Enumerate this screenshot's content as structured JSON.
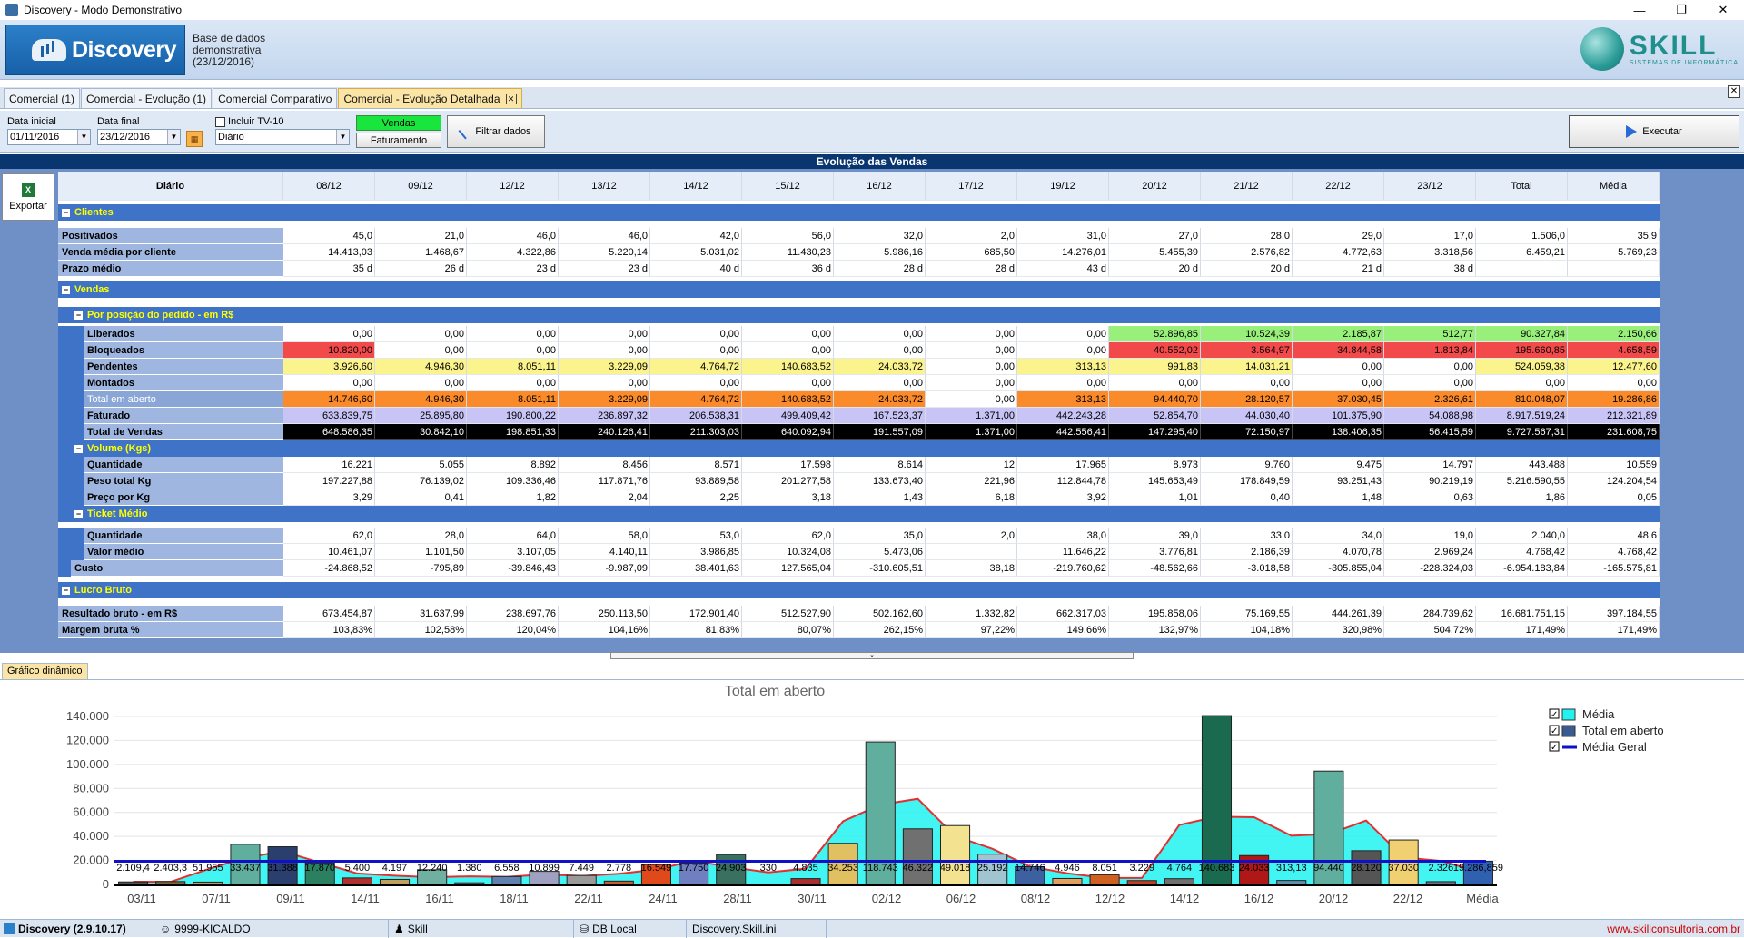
{
  "window": {
    "title": "Discovery - Modo Demonstrativo",
    "minimize": "—",
    "restore": "❐",
    "close": "✕"
  },
  "banner": {
    "app_name": "Discovery",
    "db_info": [
      "Base de dados",
      "demonstrativa",
      "(23/12/2016)"
    ],
    "brand": "SKILL",
    "brand_sub": "SISTEMAS DE INFORMÁTICA"
  },
  "tabs": [
    {
      "label": "Comercial (1)"
    },
    {
      "label": "Comercial - Evolução (1)"
    },
    {
      "label": "Comercial Comparativo"
    },
    {
      "label": "Comercial - Evolução Detalhada",
      "active": true
    }
  ],
  "toolbar": {
    "data_inicial_label": "Data inicial",
    "data_inicial": "01/11/2016",
    "data_final_label": "Data final",
    "data_final": "23/12/2016",
    "incluir_label": "Incluir TV-10",
    "periodo": "Diário",
    "vendas_label": "Vendas",
    "faturamento_label": "Faturamento",
    "filtrar_label": "Filtrar dados",
    "executar_label": "Executar",
    "export_label": "Exportar"
  },
  "section_title": "Evolução das Vendas",
  "grid": {
    "corner": "Diário",
    "columns": [
      "08/12",
      "09/12",
      "12/12",
      "13/12",
      "14/12",
      "15/12",
      "16/12",
      "17/12",
      "19/12",
      "20/12",
      "21/12",
      "22/12",
      "23/12",
      "Total",
      "Média"
    ],
    "groups": {
      "clientes": "Clientes",
      "vendas": "Vendas",
      "posicao": "Por posição do pedido - em R$",
      "volume": "Volume (Kgs)",
      "ticket": "Ticket Médio",
      "lucro": "Lucro Bruto"
    },
    "rows": {
      "positivados": {
        "label": "Positivados",
        "values": [
          "45,0",
          "21,0",
          "46,0",
          "46,0",
          "42,0",
          "56,0",
          "32,0",
          "2,0",
          "31,0",
          "27,0",
          "28,0",
          "29,0",
          "17,0",
          "1.506,0",
          "35,9"
        ]
      },
      "venda_media": {
        "label": "Venda média por cliente",
        "values": [
          "14.413,03",
          "1.468,67",
          "4.322,86",
          "5.220,14",
          "5.031,02",
          "11.430,23",
          "5.986,16",
          "685,50",
          "14.276,01",
          "5.455,39",
          "2.576,82",
          "4.772,63",
          "3.318,56",
          "6.459,21",
          "5.769,23"
        ]
      },
      "prazo": {
        "label": "Prazo médio",
        "values": [
          "35 d",
          "26 d",
          "23 d",
          "23 d",
          "40 d",
          "36 d",
          "28 d",
          "28 d",
          "43 d",
          "20 d",
          "20 d",
          "21 d",
          "38 d",
          "",
          ""
        ]
      },
      "liberados": {
        "label": "Liberados",
        "values": [
          "0,00",
          "0,00",
          "0,00",
          "0,00",
          "0,00",
          "0,00",
          "0,00",
          "0,00",
          "0,00",
          "52.896,85",
          "10.524,39",
          "2.185,87",
          "512,77",
          "90.327,84",
          "2.150,66"
        ]
      },
      "bloqueados": {
        "label": "Bloqueados",
        "values": [
          "10.820,00",
          "0,00",
          "0,00",
          "0,00",
          "0,00",
          "0,00",
          "0,00",
          "0,00",
          "0,00",
          "40.552,02",
          "3.564,97",
          "34.844,58",
          "1.813,84",
          "195.660,85",
          "4.658,59"
        ]
      },
      "pendentes": {
        "label": "Pendentes",
        "values": [
          "3.926,60",
          "4.946,30",
          "8.051,11",
          "3.229,09",
          "4.764,72",
          "140.683,52",
          "24.033,72",
          "0,00",
          "313,13",
          "991,83",
          "14.031,21",
          "0,00",
          "0,00",
          "524.059,38",
          "12.477,60"
        ]
      },
      "montados": {
        "label": "Montados",
        "values": [
          "0,00",
          "0,00",
          "0,00",
          "0,00",
          "0,00",
          "0,00",
          "0,00",
          "0,00",
          "0,00",
          "0,00",
          "0,00",
          "0,00",
          "0,00",
          "0,00",
          "0,00"
        ]
      },
      "total_aberto": {
        "label": "Total em aberto",
        "values": [
          "14.746,60",
          "4.946,30",
          "8.051,11",
          "3.229,09",
          "4.764,72",
          "140.683,52",
          "24.033,72",
          "0,00",
          "313,13",
          "94.440,70",
          "28.120,57",
          "37.030,45",
          "2.326,61",
          "810.048,07",
          "19.286,86"
        ]
      },
      "faturado": {
        "label": "Faturado",
        "values": [
          "633.839,75",
          "25.895,80",
          "190.800,22",
          "236.897,32",
          "206.538,31",
          "499.409,42",
          "167.523,37",
          "1.371,00",
          "442.243,28",
          "52.854,70",
          "44.030,40",
          "101.375,90",
          "54.088,98",
          "8.917.519,24",
          "212.321,89"
        ]
      },
      "total_vendas": {
        "label": "Total de Vendas",
        "values": [
          "648.586,35",
          "30.842,10",
          "198.851,33",
          "240.126,41",
          "211.303,03",
          "640.092,94",
          "191.557,09",
          "1.371,00",
          "442.556,41",
          "147.295,40",
          "72.150,97",
          "138.406,35",
          "56.415,59",
          "9.727.567,31",
          "231.608,75"
        ]
      },
      "quantidade_vol": {
        "label": "Quantidade",
        "values": [
          "16.221",
          "5.055",
          "8.892",
          "8.456",
          "8.571",
          "17.598",
          "8.614",
          "12",
          "17.965",
          "8.973",
          "9.760",
          "9.475",
          "14.797",
          "443.488",
          "10.559"
        ]
      },
      "peso_total": {
        "label": "Peso total Kg",
        "values": [
          "197.227,88",
          "76.139,02",
          "109.336,46",
          "117.871,76",
          "93.889,58",
          "201.277,58",
          "133.673,40",
          "221,96",
          "112.844,78",
          "145.653,49",
          "178.849,59",
          "93.251,43",
          "90.219,19",
          "5.216.590,55",
          "124.204,54"
        ]
      },
      "preco_kg": {
        "label": "Preço por Kg",
        "values": [
          "3,29",
          "0,41",
          "1,82",
          "2,04",
          "2,25",
          "3,18",
          "1,43",
          "6,18",
          "3,92",
          "1,01",
          "0,40",
          "1,48",
          "0,63",
          "1,86",
          "0,05"
        ]
      },
      "quantidade_tm": {
        "label": "Quantidade",
        "values": [
          "62,0",
          "28,0",
          "64,0",
          "58,0",
          "53,0",
          "62,0",
          "35,0",
          "2,0",
          "38,0",
          "39,0",
          "33,0",
          "34,0",
          "19,0",
          "2.040,0",
          "48,6"
        ]
      },
      "valor_medio": {
        "label": "Valor médio",
        "values": [
          "10.461,07",
          "1.101,50",
          "3.107,05",
          "4.140,11",
          "3.986,85",
          "10.324,08",
          "5.473,06",
          "",
          "11.646,22",
          "3.776,81",
          "2.186,39",
          "4.070,78",
          "2.969,24",
          "4.768,42",
          "4.768,42"
        ]
      },
      "custo": {
        "label": "Custo",
        "values": [
          "-24.868,52",
          "-795,89",
          "-39.846,43",
          "-9.987,09",
          "38.401,63",
          "127.565,04",
          "-310.605,51",
          "38,18",
          "-219.760,62",
          "-48.562,66",
          "-3.018,58",
          "-305.855,04",
          "-228.324,03",
          "-6.954.183,84",
          "-165.575,81"
        ]
      },
      "resultado": {
        "label": "Resultado bruto - em R$",
        "values": [
          "673.454,87",
          "31.637,99",
          "238.697,76",
          "250.113,50",
          "172.901,40",
          "512.527,90",
          "502.162,60",
          "1.332,82",
          "662.317,03",
          "195.858,06",
          "75.169,55",
          "444.261,39",
          "284.739,62",
          "16.681.751,15",
          "397.184,55"
        ]
      },
      "margem": {
        "label": "Margem bruta %",
        "values": [
          "103,83%",
          "102,58%",
          "120,04%",
          "104,16%",
          "81,83%",
          "80,07%",
          "262,15%",
          "97,22%",
          "149,66%",
          "132,97%",
          "104,18%",
          "320,98%",
          "504,72%",
          "171,49%",
          "171,49%"
        ]
      }
    }
  },
  "chart_tab": "Gráfico dinâmico",
  "chart_data": {
    "type": "bar",
    "title": "Total em aberto",
    "ylim": [
      0,
      140000
    ],
    "y_ticks": [
      "0",
      "20.000",
      "40.000",
      "60.000",
      "80.000",
      "100.000",
      "120.000",
      "140.000"
    ],
    "x_tick_labels": [
      "03/11",
      "07/11",
      "09/11",
      "14/11",
      "16/11",
      "18/11",
      "22/11",
      "24/11",
      "28/11",
      "30/11",
      "02/12",
      "06/12",
      "08/12",
      "12/12",
      "14/12",
      "16/12",
      "20/12",
      "22/12",
      "Média"
    ],
    "bars": [
      2109,
      2403,
      1955,
      33437,
      31388,
      17870,
      5400,
      4197,
      12240,
      1380,
      6558,
      10899,
      7449,
      2778,
      16549,
      17750,
      24903,
      330,
      4835,
      34253,
      118743,
      46322,
      49018,
      25192,
      14746,
      4946,
      8051,
      3229,
      4764,
      140683,
      24033,
      3313,
      94440,
      28120,
      37030,
      2326,
      19286
    ],
    "bar_value_labels": [
      "2.109,4",
      "2.403,3",
      "51.955",
      "33.437",
      "31.388",
      "17.870",
      "5.400",
      "4.197",
      "12.240",
      "1.380",
      "6.558",
      "10.899",
      "7.449",
      "2.778",
      "16.549",
      "17.750",
      "24.903",
      "330",
      "4.835",
      "34.253",
      "118.743",
      "46.322",
      "49.018",
      "25.192",
      "14.746",
      "4.946",
      "8.051",
      "3.229",
      "4.764",
      "140.683",
      "24.033",
      "313,13",
      "94.440",
      "28.120",
      "37.030",
      "2.326",
      "19.286,859"
    ],
    "bar_colors": [
      "#555555",
      "#7a6a3a",
      "#b0a070",
      "#5fae9e",
      "#2b3f6e",
      "#2a8060",
      "#b03030",
      "#c0a060",
      "#6fb0a0",
      "#9090a0",
      "#6080b0",
      "#a0a0c0",
      "#9a9a9a",
      "#c06030",
      "#e04a1a",
      "#6f7fc0",
      "#3a7060",
      "#5f6a9a",
      "#a83030",
      "#e0c060",
      "#5fae9e",
      "#707070",
      "#f3e390",
      "#a0c4d0",
      "#3d60a0",
      "#e0a060",
      "#d06020",
      "#c04020",
      "#707070",
      "#1a6a50",
      "#b01818",
      "#6090b0",
      "#5fae9e",
      "#555555",
      "#f0d070",
      "#707080",
      "#3060b0"
    ],
    "media_geral": 19286,
    "series": [
      {
        "name": "Média"
      },
      {
        "name": "Total em aberto"
      },
      {
        "name": "Média Geral"
      }
    ],
    "legend": "right"
  },
  "status": {
    "app": "Discovery (2.9.10.17)",
    "user": "9999-KICALDO",
    "company": "Skill",
    "db": "DB Local",
    "ini": "Discovery.Skill.ini",
    "url": "www.skillconsultoria.com.br"
  }
}
